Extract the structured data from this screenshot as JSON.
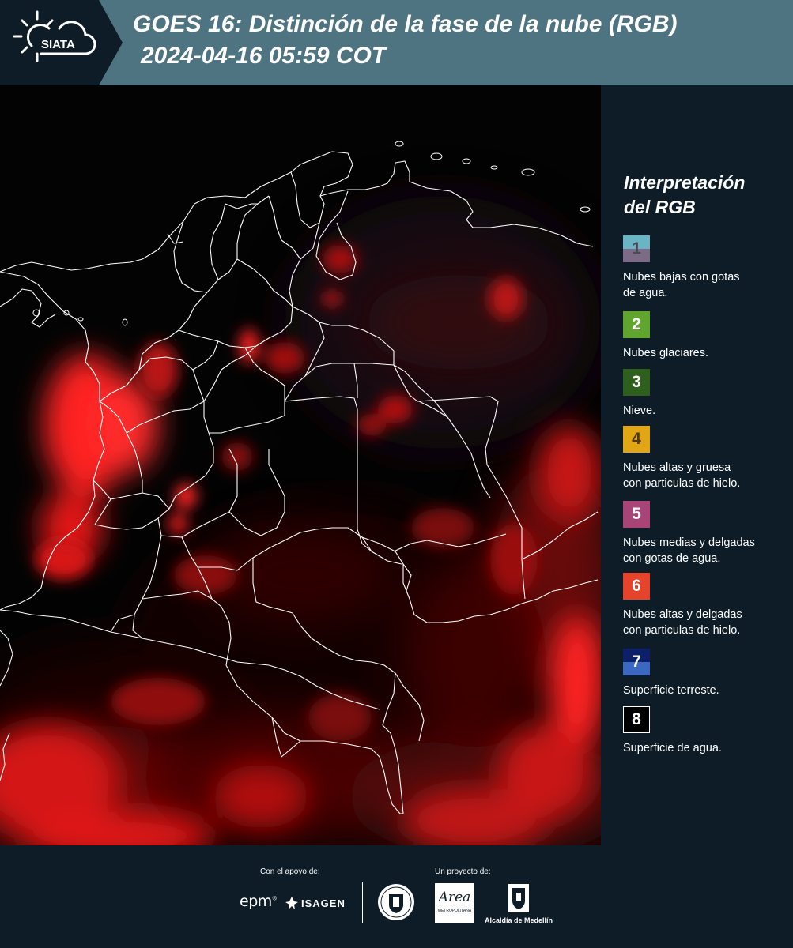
{
  "header": {
    "logo_text": "SIATA",
    "title_line1": "GOES 16: Distinción de la fase de la nube (RGB)",
    "title_line2": "2024-04-16 05:59 COT"
  },
  "legend": {
    "title_line1": "Interpretación",
    "title_line2": "del RGB",
    "items": [
      {
        "number": "1",
        "label_line1": "Nubes bajas con gotas",
        "label_line2": "de agua.",
        "color_top": "#6ab4c4",
        "color_bottom": "#7b6b87"
      },
      {
        "number": "2",
        "label_line1": "Nubes glaciares.",
        "label_line2": "",
        "color_top": "#5fa52e",
        "color_bottom": "#5fa52e"
      },
      {
        "number": "3",
        "label_line1": "Nieve.",
        "label_line2": "",
        "color_top": "#2e5f1c",
        "color_bottom": "#2e5f1c"
      },
      {
        "number": "4",
        "label_line1": "Nubes altas y gruesa",
        "label_line2": "con particulas de hielo.",
        "color_top": "#e0a614",
        "color_bottom": "#e0a614"
      },
      {
        "number": "5",
        "label_line1": "Nubes medias y delgadas",
        "label_line2": "con gotas de agua.",
        "color_top": "#a84477",
        "color_bottom": "#a84477"
      },
      {
        "number": "6",
        "label_line1": "Nubes altas y delgadas",
        "label_line2": "con particulas de hielo.",
        "color_top": "#e5432a",
        "color_bottom": "#e5432a"
      },
      {
        "number": "7",
        "label_line1": "Superficie terreste.",
        "label_line2": "",
        "color_top": "#0c1f6b",
        "color_bottom": "#3d68c1"
      },
      {
        "number": "8",
        "label_line1": "Superficie de agua.",
        "label_line2": "",
        "color_top": "#000000",
        "color_bottom": "#000000"
      }
    ]
  },
  "footer": {
    "support_label": "Con el apoyo de:",
    "project_label": "Un proyecto de:",
    "epm_logo": "epm",
    "isagen_logo": "ISAGEN",
    "area_logo_text": "Area",
    "area_logo_sub": "METROPOLITANA",
    "alcaldia_label": "Alcaldía de Medellín"
  },
  "colors": {
    "header_bg": "#4e7482",
    "panel_bg": "#0d1c27",
    "cloud_red": "#ff1a1a"
  }
}
